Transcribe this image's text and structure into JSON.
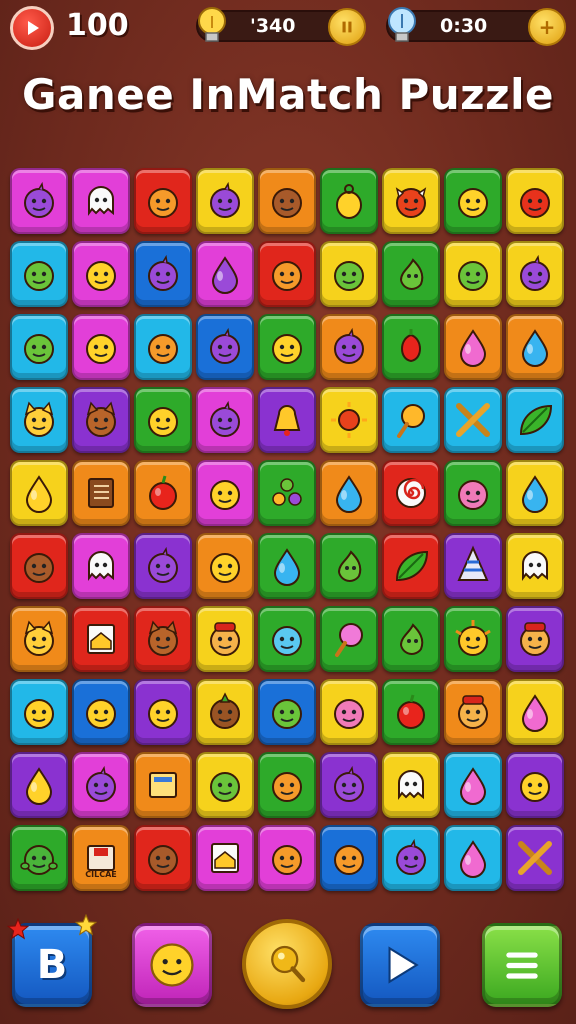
{
  "hud": {
    "lives": "100",
    "hints_value": "'340",
    "timer_value": "0:30",
    "coin_symbol": "+"
  },
  "title": "Ganee InMatch Puzzle",
  "colors": {
    "magenta": "#e23fd8",
    "red": "#e0261c",
    "yellow": "#f6d21c",
    "orange": "#f08a1a",
    "green": "#2eaa2a",
    "blue": "#1a70d8",
    "cyan": "#22b8e8",
    "purple": "#8a32d0",
    "pink": "#f03aa8"
  },
  "board": {
    "rows": [
      [
        {
          "bg": "magenta",
          "icon": "purple-face"
        },
        {
          "bg": "magenta",
          "icon": "white-ghost"
        },
        {
          "bg": "red",
          "icon": "orange-face"
        },
        {
          "bg": "yellow",
          "icon": "purple-face"
        },
        {
          "bg": "orange",
          "icon": "brown-face"
        },
        {
          "bg": "green",
          "icon": "yellow-bag"
        },
        {
          "bg": "yellow",
          "icon": "red-crab"
        },
        {
          "bg": "green",
          "icon": "yellow-face"
        },
        {
          "bg": "yellow",
          "icon": "red-face"
        }
      ],
      [
        {
          "bg": "cyan",
          "icon": "green-face"
        },
        {
          "bg": "magenta",
          "icon": "yellow-face"
        },
        {
          "bg": "blue",
          "icon": "purple-face"
        },
        {
          "bg": "magenta",
          "icon": "purple-drop"
        },
        {
          "bg": "red",
          "icon": "orange-face"
        },
        {
          "bg": "yellow",
          "icon": "green-face"
        },
        {
          "bg": "green",
          "icon": "green-pear"
        },
        {
          "bg": "yellow",
          "icon": "green-face"
        },
        {
          "bg": "yellow",
          "icon": "purple-face"
        }
      ],
      [
        {
          "bg": "cyan",
          "icon": "green-face"
        },
        {
          "bg": "magenta",
          "icon": "yellow-face"
        },
        {
          "bg": "cyan",
          "icon": "orange-face"
        },
        {
          "bg": "blue",
          "icon": "purple-face"
        },
        {
          "bg": "green",
          "icon": "yellow-face"
        },
        {
          "bg": "orange",
          "icon": "purple-face"
        },
        {
          "bg": "green",
          "icon": "red-pepper"
        },
        {
          "bg": "orange",
          "icon": "pink-drop"
        },
        {
          "bg": "orange",
          "icon": "cyan-drop"
        }
      ],
      [
        {
          "bg": "cyan",
          "icon": "yellow-cat"
        },
        {
          "bg": "purple",
          "icon": "brown-cat"
        },
        {
          "bg": "green",
          "icon": "yellow-face"
        },
        {
          "bg": "magenta",
          "icon": "purple-face"
        },
        {
          "bg": "purple",
          "icon": "yellow-bell"
        },
        {
          "bg": "yellow",
          "icon": "red-sun"
        },
        {
          "bg": "cyan",
          "icon": "orange-lolly"
        },
        {
          "bg": "cyan",
          "icon": "crossed-sticks"
        },
        {
          "bg": "cyan",
          "icon": "green-leaf"
        }
      ],
      [
        {
          "bg": "yellow",
          "icon": "yellow-drop"
        },
        {
          "bg": "orange",
          "icon": "book"
        },
        {
          "bg": "orange",
          "icon": "red-apple"
        },
        {
          "bg": "magenta",
          "icon": "yellow-face"
        },
        {
          "bg": "green",
          "icon": "dots"
        },
        {
          "bg": "orange",
          "icon": "cyan-drop"
        },
        {
          "bg": "red",
          "icon": "spiral"
        },
        {
          "bg": "green",
          "icon": "pink-face"
        },
        {
          "bg": "yellow",
          "icon": "cyan-drop"
        }
      ],
      [
        {
          "bg": "red",
          "icon": "brown-face"
        },
        {
          "bg": "magenta",
          "icon": "white-ghost"
        },
        {
          "bg": "purple",
          "icon": "purple-face"
        },
        {
          "bg": "orange",
          "icon": "yellow-face"
        },
        {
          "bg": "green",
          "icon": "cyan-drop"
        },
        {
          "bg": "green",
          "icon": "green-pear"
        },
        {
          "bg": "red",
          "icon": "green-leaf"
        },
        {
          "bg": "purple",
          "icon": "striped-cone"
        },
        {
          "bg": "yellow",
          "icon": "white-ghost"
        }
      ],
      [
        {
          "bg": "orange",
          "icon": "yellow-cat"
        },
        {
          "bg": "red",
          "icon": "envelope"
        },
        {
          "bg": "red",
          "icon": "brown-cat"
        },
        {
          "bg": "yellow",
          "icon": "red-hat-face"
        },
        {
          "bg": "green",
          "icon": "cyan-face"
        },
        {
          "bg": "green",
          "icon": "pink-lolly"
        },
        {
          "bg": "green",
          "icon": "green-pear"
        },
        {
          "bg": "green",
          "icon": "yellow-sun"
        },
        {
          "bg": "purple",
          "icon": "red-hat-face"
        }
      ],
      [
        {
          "bg": "cyan",
          "icon": "yellow-face"
        },
        {
          "bg": "blue",
          "icon": "yellow-face"
        },
        {
          "bg": "purple",
          "icon": "yellow-face"
        },
        {
          "bg": "yellow",
          "icon": "brown-onion"
        },
        {
          "bg": "blue",
          "icon": "green-face"
        },
        {
          "bg": "yellow",
          "icon": "pink-face"
        },
        {
          "bg": "green",
          "icon": "red-apple"
        },
        {
          "bg": "orange",
          "icon": "red-hat-face"
        },
        {
          "bg": "yellow",
          "icon": "pink-drop"
        }
      ],
      [
        {
          "bg": "purple",
          "icon": "yellow-drop"
        },
        {
          "bg": "magenta",
          "icon": "purple-face"
        },
        {
          "bg": "orange",
          "icon": "note-card"
        },
        {
          "bg": "yellow",
          "icon": "green-face"
        },
        {
          "bg": "green",
          "icon": "orange-face"
        },
        {
          "bg": "purple",
          "icon": "purple-face"
        },
        {
          "bg": "yellow",
          "icon": "white-ghost"
        },
        {
          "bg": "cyan",
          "icon": "pink-drop"
        },
        {
          "bg": "purple",
          "icon": "yellow-face"
        }
      ],
      [
        {
          "bg": "green",
          "icon": "green-turtle"
        },
        {
          "bg": "orange",
          "icon": "cigar-box",
          "text": "CILCAE"
        },
        {
          "bg": "red",
          "icon": "brown-face"
        },
        {
          "bg": "magenta",
          "icon": "envelope"
        },
        {
          "bg": "magenta",
          "icon": "orange-face"
        },
        {
          "bg": "blue",
          "icon": "orange-face"
        },
        {
          "bg": "cyan",
          "icon": "purple-face"
        },
        {
          "bg": "cyan",
          "icon": "pink-drop"
        },
        {
          "bg": "purple",
          "icon": "crossed-sticks"
        }
      ]
    ]
  },
  "bottom": {
    "b_button_label": "B",
    "buttons": [
      "b-booster-button",
      "face-booster-button",
      "coin-hint-button",
      "next-button",
      "menu-button"
    ]
  }
}
